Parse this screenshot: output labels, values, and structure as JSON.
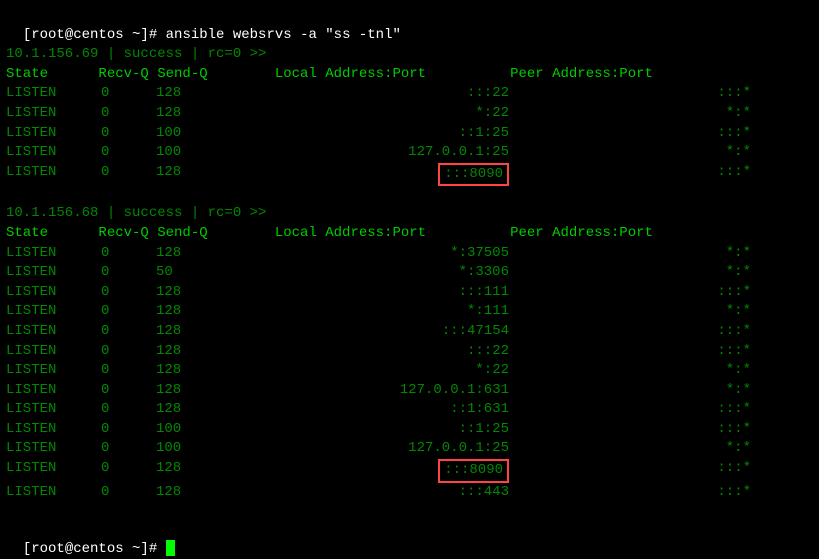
{
  "prompt1": "[root@centos ~]# ",
  "command": "ansible websrvs -a \"ss -tnl\"",
  "host1": {
    "header": "10.1.156.69 | success | rc=0 >>",
    "columns": "State      Recv-Q Send-Q        Local Address:Port          Peer Address:Port",
    "rows": [
      {
        "state": "LISTEN",
        "recvq": "0",
        "sendq": "128",
        "local": ":::22",
        "peer": ":::*",
        "hl": false
      },
      {
        "state": "LISTEN",
        "recvq": "0",
        "sendq": "128",
        "local": "*:22",
        "peer": "*:*",
        "hl": false
      },
      {
        "state": "LISTEN",
        "recvq": "0",
        "sendq": "100",
        "local": "::1:25",
        "peer": ":::*",
        "hl": false
      },
      {
        "state": "LISTEN",
        "recvq": "0",
        "sendq": "100",
        "local": "127.0.0.1:25",
        "peer": "*:*",
        "hl": false
      },
      {
        "state": "LISTEN",
        "recvq": "0",
        "sendq": "128",
        "local": ":::8090",
        "peer": ":::*",
        "hl": true
      }
    ]
  },
  "host2": {
    "header": "10.1.156.68 | success | rc=0 >>",
    "columns": "State      Recv-Q Send-Q        Local Address:Port          Peer Address:Port",
    "rows": [
      {
        "state": "LISTEN",
        "recvq": "0",
        "sendq": "128",
        "local": "*:37505",
        "peer": "*:*",
        "hl": false
      },
      {
        "state": "LISTEN",
        "recvq": "0",
        "sendq": "50",
        "local": "*:3306",
        "peer": "*:*",
        "hl": false
      },
      {
        "state": "LISTEN",
        "recvq": "0",
        "sendq": "128",
        "local": ":::111",
        "peer": ":::*",
        "hl": false
      },
      {
        "state": "LISTEN",
        "recvq": "0",
        "sendq": "128",
        "local": "*:111",
        "peer": "*:*",
        "hl": false
      },
      {
        "state": "LISTEN",
        "recvq": "0",
        "sendq": "128",
        "local": ":::47154",
        "peer": ":::*",
        "hl": false
      },
      {
        "state": "LISTEN",
        "recvq": "0",
        "sendq": "128",
        "local": ":::22",
        "peer": ":::*",
        "hl": false
      },
      {
        "state": "LISTEN",
        "recvq": "0",
        "sendq": "128",
        "local": "*:22",
        "peer": "*:*",
        "hl": false
      },
      {
        "state": "LISTEN",
        "recvq": "0",
        "sendq": "128",
        "local": "127.0.0.1:631",
        "peer": "*:*",
        "hl": false
      },
      {
        "state": "LISTEN",
        "recvq": "0",
        "sendq": "128",
        "local": "::1:631",
        "peer": ":::*",
        "hl": false
      },
      {
        "state": "LISTEN",
        "recvq": "0",
        "sendq": "100",
        "local": "::1:25",
        "peer": ":::*",
        "hl": false
      },
      {
        "state": "LISTEN",
        "recvq": "0",
        "sendq": "100",
        "local": "127.0.0.1:25",
        "peer": "*:*",
        "hl": false
      },
      {
        "state": "LISTEN",
        "recvq": "0",
        "sendq": "128",
        "local": ":::8090",
        "peer": ":::*",
        "hl": true
      },
      {
        "state": "LISTEN",
        "recvq": "0",
        "sendq": "128",
        "local": ":::443",
        "peer": ":::*",
        "hl": false
      }
    ]
  },
  "prompt2": "[root@centos ~]# "
}
